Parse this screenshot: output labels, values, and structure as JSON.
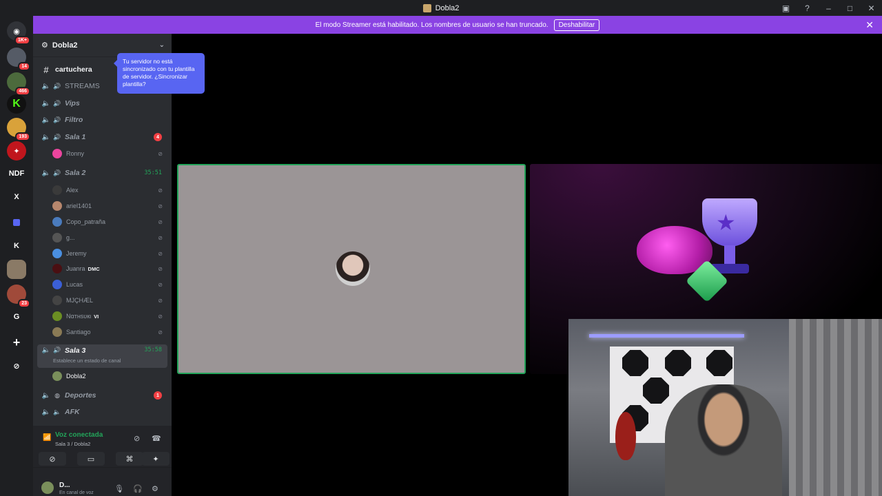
{
  "window": {
    "title": "Dobla2"
  },
  "banner": {
    "text": "El modo Streamer está habilitado. Los nombres de usuario se han truncado.",
    "button": "Deshabilitar"
  },
  "guilds": [
    {
      "label": "",
      "badge": "1K+"
    },
    {
      "label": "",
      "badge": "14"
    },
    {
      "label": "",
      "badge": "466"
    },
    {
      "label": "K",
      "badge": ""
    },
    {
      "label": "",
      "badge": "193"
    },
    {
      "label": "",
      "badge": ""
    },
    {
      "label": "NDF",
      "badge": ""
    },
    {
      "label": "X",
      "badge": ""
    },
    {
      "label": "",
      "badge": ""
    },
    {
      "label": "K",
      "badge": ""
    },
    {
      "label": "",
      "badge": ""
    },
    {
      "label": "",
      "badge": "23"
    },
    {
      "label": "G",
      "badge": ""
    },
    {
      "label": "+",
      "badge": ""
    },
    {
      "label": "",
      "badge": ""
    }
  ],
  "server": {
    "name": "Dobla2",
    "tooltip": "Tu servidor no está sincronizado con tu plantilla de servidor. ¿Sincronizar plantilla?"
  },
  "channels": {
    "cartuchera": "cartuchera",
    "streams": "STREAMS",
    "vips": "Vips",
    "filtro": "Filtro",
    "sala1": {
      "name": "Sala 1",
      "count": "4"
    },
    "sala2": {
      "name": "Sala 2",
      "time": "35:51"
    },
    "sala3": {
      "name": "Sala 3",
      "time": "35:58",
      "status": "Establece un estado de canal"
    },
    "deportes": {
      "name": "Deportes",
      "count": "1"
    },
    "afk": "AFK"
  },
  "sala1_users": [
    "Ronny"
  ],
  "sala2_users": [
    "Alex",
    "ariel1401",
    "Copo_patraña",
    "g...",
    "Jeremy",
    "Juanra",
    "Lucas",
    "MJÇHÆL",
    "Nαтнѕυкι",
    "Santiago"
  ],
  "tags": {
    "juanra": "DMC",
    "nathsuki": "VI"
  },
  "sala3_users": [
    "Dobla2"
  ],
  "voice": {
    "title": "Voz conectada",
    "sub": "Sala 3 / Dobla2"
  },
  "user": {
    "name": "D...",
    "status": "En canal de voz"
  },
  "colors": {
    "accent": "#5865f2",
    "streamer_banner": "#8a43e3",
    "connected": "#23a55a",
    "badge": "#f23f43"
  }
}
